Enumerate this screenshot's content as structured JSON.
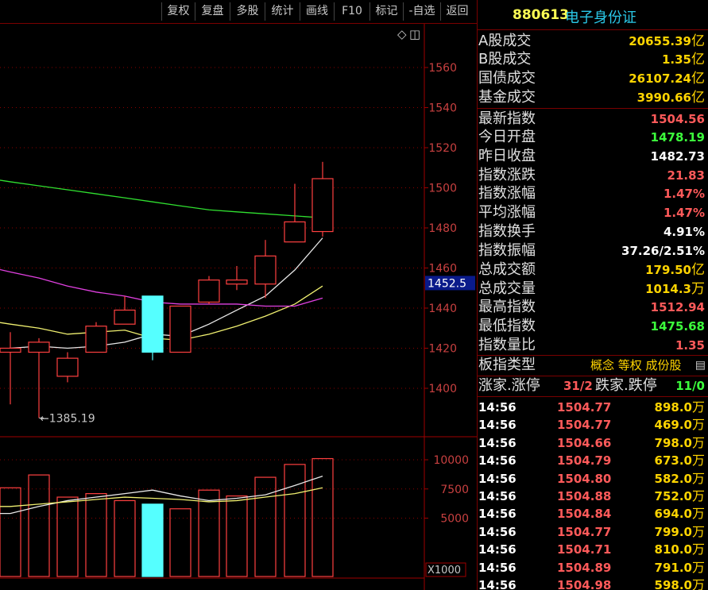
{
  "toolbar": {
    "buttons": [
      "复权",
      "复盘",
      "多股",
      "统计",
      "画线",
      "F10",
      "标记",
      "-自选",
      "返回"
    ]
  },
  "chart_icons": {
    "diamond": "◇",
    "window": "◫"
  },
  "chart_data": {
    "type": "candlestick",
    "price_axis": {
      "ticks": [
        "1560",
        "1540",
        "1520",
        "1500",
        "1480",
        "1460",
        "1440",
        "1420",
        "1400"
      ],
      "range": [
        1382,
        1580
      ]
    },
    "current_price_label": "1452.5",
    "low_annotation": "←1385.19",
    "candles": [
      {
        "open": 1420,
        "close": 1418,
        "high": 1428,
        "low": 1392,
        "color": "red"
      },
      {
        "open": 1418,
        "close": 1423,
        "high": 1425,
        "low": 1385.19,
        "color": "red"
      },
      {
        "open": 1406,
        "close": 1415,
        "high": 1418,
        "low": 1403,
        "color": "red"
      },
      {
        "open": 1418,
        "close": 1431,
        "high": 1433,
        "low": 1418,
        "color": "red"
      },
      {
        "open": 1432,
        "close": 1439,
        "high": 1446,
        "low": 1432,
        "color": "red"
      },
      {
        "open": 1446,
        "close": 1418,
        "high": 1446,
        "low": 1414,
        "color": "cyan"
      },
      {
        "open": 1418,
        "close": 1441,
        "high": 1441,
        "low": 1418,
        "color": "red"
      },
      {
        "open": 1443,
        "close": 1454,
        "high": 1456,
        "low": 1442,
        "color": "red"
      },
      {
        "open": 1452,
        "close": 1454,
        "high": 1461,
        "low": 1449,
        "color": "red"
      },
      {
        "open": 1452,
        "close": 1466,
        "high": 1474,
        "low": 1445,
        "color": "red"
      },
      {
        "open": 1473,
        "close": 1483,
        "high": 1502,
        "low": 1473,
        "color": "red"
      },
      {
        "open": 1478.19,
        "close": 1504.56,
        "high": 1512.94,
        "low": 1475.68,
        "color": "red"
      }
    ],
    "ma_lines": [
      {
        "name": "ma_white",
        "color": "#e8e8e8",
        "values": [
          1420,
          1421,
          1420,
          1421,
          1423,
          1427,
          1426,
          1432,
          1439,
          1446,
          1459,
          1475
        ]
      },
      {
        "name": "ma_yellow",
        "color": "#f0f070",
        "values": [
          1432,
          1430,
          1427,
          1428,
          1429,
          1425,
          1424,
          1427,
          1431,
          1436,
          1442,
          1451
        ]
      },
      {
        "name": "ma_magenta",
        "color": "#e040e0",
        "values": [
          1458,
          1455,
          1451,
          1448,
          1446,
          1443,
          1442,
          1442,
          1442,
          1441,
          1441,
          1445
        ]
      },
      {
        "name": "ma_green",
        "color": "#30e030",
        "values": [
          1503,
          1501,
          1499,
          1497,
          1495,
          1493,
          1491,
          1489,
          1488,
          1487,
          1486,
          1485
        ]
      }
    ],
    "volume_axis": {
      "ticks": [
        "10000",
        "7500",
        "5000"
      ],
      "range": [
        0,
        10500
      ],
      "unit_label": "X1000"
    },
    "volumes": [
      {
        "value": 7600,
        "color": "red"
      },
      {
        "value": 8700,
        "color": "red"
      },
      {
        "value": 6800,
        "color": "red"
      },
      {
        "value": 7100,
        "color": "red"
      },
      {
        "value": 6500,
        "color": "red"
      },
      {
        "value": 6200,
        "color": "cyan"
      },
      {
        "value": 5800,
        "color": "red"
      },
      {
        "value": 7400,
        "color": "red"
      },
      {
        "value": 6900,
        "color": "red"
      },
      {
        "value": 8500,
        "color": "red"
      },
      {
        "value": 9600,
        "color": "red"
      },
      {
        "value": 10100,
        "color": "red"
      }
    ],
    "vol_ma_lines": [
      {
        "name": "vol_ma_white",
        "color": "#e8e8e8",
        "values": [
          5400,
          6000,
          6500,
          6800,
          7100,
          7400,
          6900,
          6500,
          6700,
          7000,
          7800,
          8600
        ]
      },
      {
        "name": "vol_ma_yellow",
        "color": "#f0f070",
        "values": [
          6000,
          6200,
          6400,
          6600,
          6800,
          6700,
          6600,
          6400,
          6500,
          6800,
          7100,
          7600
        ]
      }
    ]
  },
  "panel": {
    "code": "880613",
    "name": "电子身份证",
    "stats": [
      {
        "label": "A股成交",
        "value": "20655.39",
        "unit": "亿",
        "color": "#ffd400"
      },
      {
        "label": "B股成交",
        "value": "1.35",
        "unit": "亿",
        "color": "#ffd400"
      },
      {
        "label": "国债成交",
        "value": "26107.24",
        "unit": "亿",
        "color": "#ffd400"
      },
      {
        "label": "基金成交",
        "value": "3990.66",
        "unit": "亿",
        "color": "#ffd400"
      },
      {
        "label": "最新指数",
        "value": "1504.56",
        "unit": "",
        "color": "#ff5a5a"
      },
      {
        "label": "今日开盘",
        "value": "1478.19",
        "unit": "",
        "color": "#3cff3c"
      },
      {
        "label": "昨日收盘",
        "value": "1482.73",
        "unit": "",
        "color": "#ffffff"
      },
      {
        "label": "指数涨跌",
        "value": "21.83",
        "unit": "",
        "color": "#ff5a5a"
      },
      {
        "label": "指数涨幅",
        "value": "1.47%",
        "unit": "",
        "color": "#ff5a5a"
      },
      {
        "label": "平均涨幅",
        "value": "1.47%",
        "unit": "",
        "color": "#ff5a5a"
      },
      {
        "label": "指数换手",
        "value": "4.91%",
        "unit": "",
        "color": "#ffffff"
      },
      {
        "label": "指数振幅",
        "value": "37.26/2.51%",
        "unit": "",
        "color": "#ffffff"
      },
      {
        "label": "总成交额",
        "value": "179.50",
        "unit": "亿",
        "color": "#ffd400"
      },
      {
        "label": "总成交量",
        "value": "1014.3",
        "unit": "万",
        "color": "#ffd400"
      },
      {
        "label": "最高指数",
        "value": "1512.94",
        "unit": "",
        "color": "#ff5a5a"
      },
      {
        "label": "最低指数",
        "value": "1475.68",
        "unit": "",
        "color": "#3cff3c"
      },
      {
        "label": "指数量比",
        "value": "1.35",
        "unit": "",
        "color": "#ff5a5a"
      }
    ],
    "type_row": {
      "label": "板指类型",
      "tags": "概念 等权 成份股",
      "icon": "▤"
    },
    "updown_row": {
      "label1": "涨家.涨停",
      "value1": "31/2",
      "label2": "跌家.跌停",
      "value2": "11/0"
    },
    "ticks": [
      {
        "time": "14:56",
        "price": "1504.77",
        "vol": "898.0",
        "unit": "万"
      },
      {
        "time": "14:56",
        "price": "1504.77",
        "vol": "469.0",
        "unit": "万"
      },
      {
        "time": "14:56",
        "price": "1504.66",
        "vol": "798.0",
        "unit": "万"
      },
      {
        "time": "14:56",
        "price": "1504.79",
        "vol": "673.0",
        "unit": "万"
      },
      {
        "time": "14:56",
        "price": "1504.80",
        "vol": "582.0",
        "unit": "万"
      },
      {
        "time": "14:56",
        "price": "1504.88",
        "vol": "752.0",
        "unit": "万"
      },
      {
        "time": "14:56",
        "price": "1504.84",
        "vol": "694.0",
        "unit": "万"
      },
      {
        "time": "14:56",
        "price": "1504.77",
        "vol": "799.0",
        "unit": "万"
      },
      {
        "time": "14:56",
        "price": "1504.71",
        "vol": "810.0",
        "unit": "万"
      },
      {
        "time": "14:56",
        "price": "1504.89",
        "vol": "791.0",
        "unit": "万"
      },
      {
        "time": "14:56",
        "price": "1504.98",
        "vol": "598.0",
        "unit": "万"
      }
    ]
  }
}
